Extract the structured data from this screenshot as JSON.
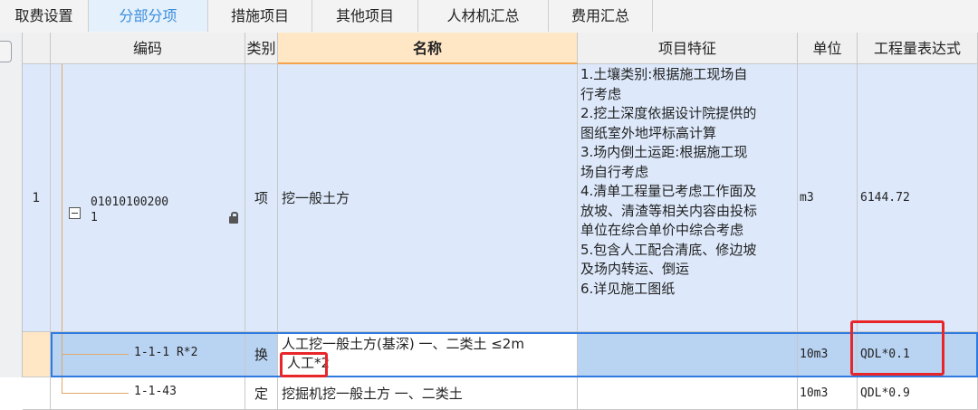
{
  "tabs": [
    {
      "label": "取费设置"
    },
    {
      "label": "分部分项"
    },
    {
      "label": "措施项目"
    },
    {
      "label": "其他项目"
    },
    {
      "label": "人材机汇总"
    },
    {
      "label": "费用汇总"
    }
  ],
  "active_tab": "分部分项",
  "columns": {
    "code": "编码",
    "type": "类别",
    "name": "名称",
    "feature": "项目特征",
    "unit": "单位",
    "expr": "工程量表达式"
  },
  "rows": [
    {
      "index": "1",
      "code_line1": "01010100200",
      "code_line2": "1",
      "type": "项",
      "name": "挖一般土方",
      "feature": "1.土壤类别:根据施工现场自\n行考虑\n2.挖土深度依据设计院提供的\n图纸室外地坪标高计算\n3.场内倒土运距:根据施工现\n场自行考虑\n4.清单工程量已考虑工作面及\n放坡、清渣等相关内容由投标\n单位在综合单价中综合考虑\n5.包含人工配合清底、修边坡\n及场内转运、倒运\n6.详见施工图纸",
      "unit": "m3",
      "expr": "6144.72"
    },
    {
      "index": "",
      "code": "1-1-1 R*2",
      "type": "换",
      "name_line1": "人工挖一般土方(基深) 一、二类土 ≤2m",
      "name_line2": "人工*2",
      "feature": "",
      "unit": "10m3",
      "expr": "QDL*0.1"
    },
    {
      "index": "",
      "code": "1-1-43",
      "type": "定",
      "name": "挖掘机挖一般土方 一、二类土",
      "feature": "",
      "unit": "10m3",
      "expr": "QDL*0.9"
    }
  ],
  "colors": {
    "active_tab_text": "#3b8ede",
    "row_bg": "#dde9fb",
    "selected_row_bg": "#b9d3f3",
    "selected_header_bg": "#ffe7c6",
    "selection_outline": "#2f7ae0",
    "highlight_box": "#e8262a"
  },
  "icons": {
    "expand": "minus-box-icon",
    "lock": "lock-icon"
  }
}
